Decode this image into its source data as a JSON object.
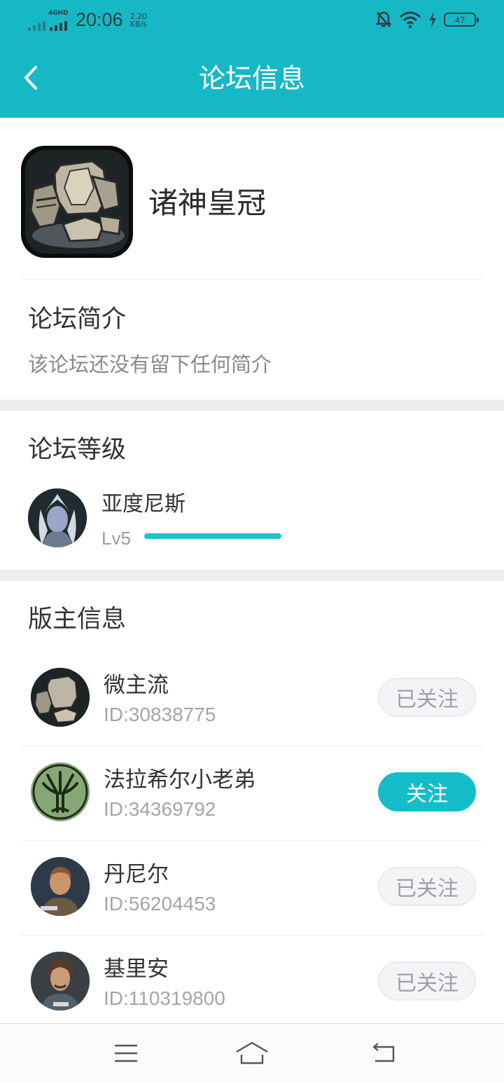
{
  "status_bar": {
    "network": "4GHD",
    "time": "20:06",
    "speed_value": "2.20",
    "speed_unit": "KB/s",
    "battery": "47"
  },
  "header": {
    "title": "论坛信息",
    "back_icon": "chevron-left-icon"
  },
  "forum": {
    "name": "诸神皇冠",
    "icon": "armor-icon"
  },
  "intro": {
    "title": "论坛简介",
    "text": "该论坛还没有留下任何简介"
  },
  "level": {
    "title": "论坛等级",
    "user_name": "亚度尼斯",
    "level_label": "Lv5",
    "progress": 1.0
  },
  "moderators": {
    "title": "版主信息",
    "items": [
      {
        "name": "微主流",
        "id": "ID:30838775",
        "button": "已关注",
        "followed": true
      },
      {
        "name": "法拉希尔小老弟",
        "id": "ID:34369792",
        "button": "关注",
        "followed": false
      },
      {
        "name": "丹尼尔",
        "id": "ID:56204453",
        "button": "已关注",
        "followed": true
      },
      {
        "name": "基里安",
        "id": "ID:110319800",
        "button": "已关注",
        "followed": true
      }
    ]
  },
  "bottom_nav": {
    "items": [
      "menu-icon",
      "home-icon",
      "back-icon"
    ]
  },
  "colors": {
    "accent": "#17b8c6",
    "follow_active": "#15bcc9",
    "followed_bg": "#f3f4f6"
  }
}
